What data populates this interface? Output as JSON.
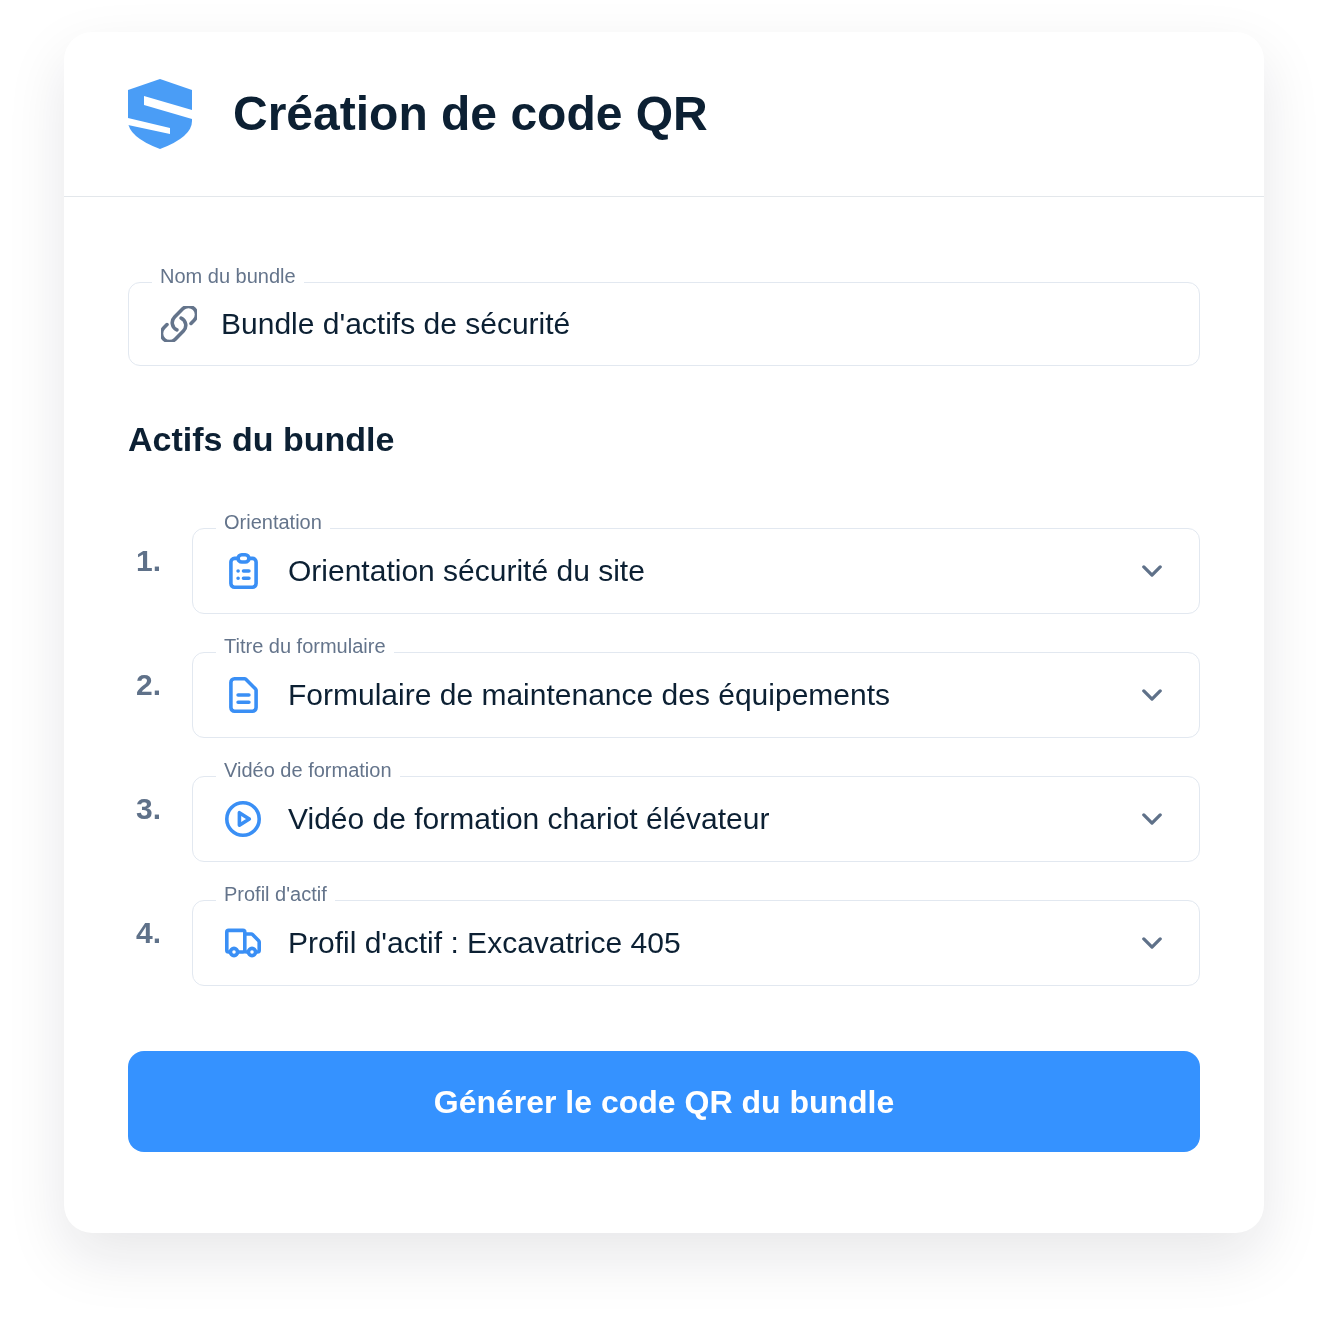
{
  "header": {
    "title": "Création de code QR"
  },
  "bundle_name": {
    "label": "Nom du bundle",
    "value": "Bundle d'actifs de sécurité"
  },
  "assets": {
    "title": "Actifs du bundle",
    "items": [
      {
        "number": "1.",
        "label": "Orientation",
        "value": "Orientation sécurité du site",
        "kind": "orientation"
      },
      {
        "number": "2.",
        "label": "Titre du formulaire",
        "value": "Formulaire de maintenance des équipements",
        "kind": "form"
      },
      {
        "number": "3.",
        "label": "Vidéo de formation",
        "value": "Vidéo de formation chariot élévateur",
        "kind": "video"
      },
      {
        "number": "4.",
        "label": "Profil d'actif",
        "value": "Profil d'actif : Excavatrice 405",
        "kind": "asset_profile"
      }
    ]
  },
  "generate_button": {
    "label": "Générer le code QR du bundle"
  }
}
